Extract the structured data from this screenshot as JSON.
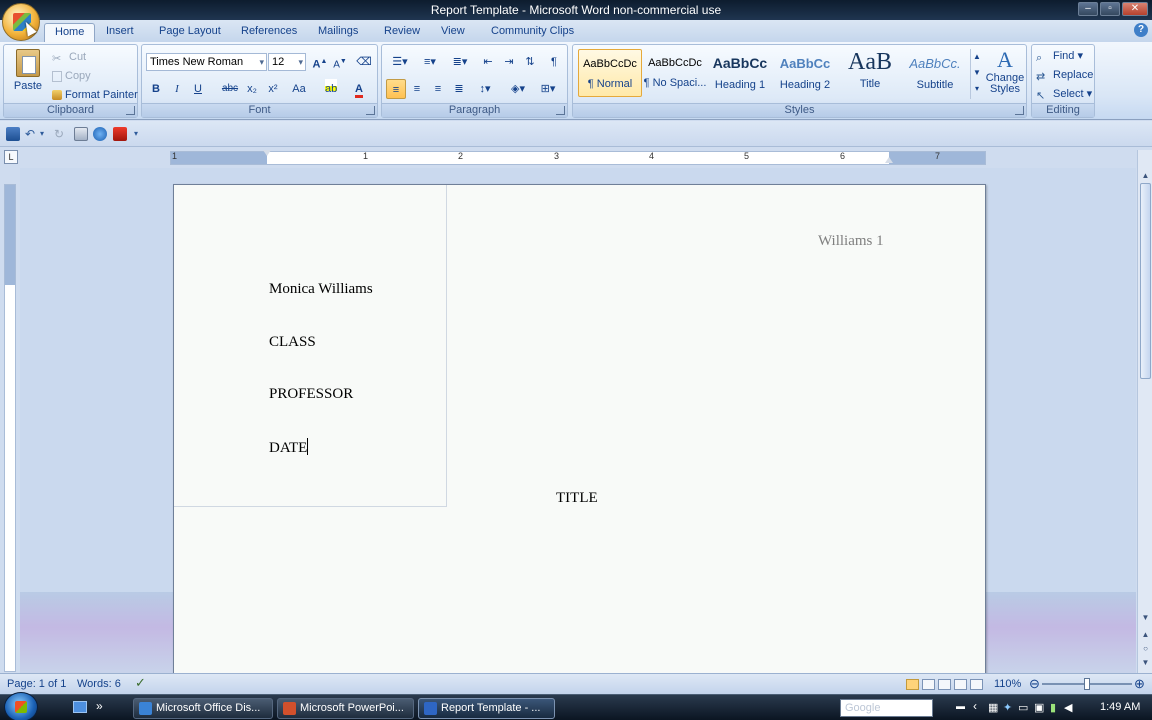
{
  "window": {
    "title": "Report Template - Microsoft Word non-commercial use"
  },
  "tabs": [
    "Home",
    "Insert",
    "Page Layout",
    "References",
    "Mailings",
    "Review",
    "View",
    "Community Clips"
  ],
  "clipboard": {
    "paste": "Paste",
    "cut": "Cut",
    "copy": "Copy",
    "format_painter": "Format Painter",
    "label": "Clipboard"
  },
  "font": {
    "name": "Times New Roman",
    "size": "12",
    "label": "Font",
    "bold": "B",
    "italic": "I",
    "underline": "U",
    "strike": "abc",
    "sub": "x₂",
    "sup": "x²",
    "case": "Aa",
    "grow": "A",
    "shrink": "A",
    "color": "A"
  },
  "paragraph": {
    "label": "Paragraph",
    "pilcrow": "¶"
  },
  "styles": {
    "label": "Styles",
    "items": [
      {
        "sample": "AaBbCcDc",
        "name": "¶ Normal"
      },
      {
        "sample": "AaBbCcDc",
        "name": "¶ No Spaci..."
      },
      {
        "sample": "AaBbCc",
        "name": "Heading 1"
      },
      {
        "sample": "AaBbCc",
        "name": "Heading 2"
      },
      {
        "sample": "AaB",
        "name": "Title"
      },
      {
        "sample": "AaBbCc.",
        "name": "Subtitle"
      }
    ],
    "change_styles": "Change Styles"
  },
  "editing": {
    "find": "Find",
    "replace": "Replace",
    "select": "Select",
    "label": "Editing"
  },
  "ruler": {
    "numbers": [
      "1",
      "1",
      "2",
      "3",
      "4",
      "5",
      "6",
      "7"
    ],
    "toggle": "L"
  },
  "document": {
    "header": "Williams 1",
    "lines": [
      "Monica Williams",
      "CLASS",
      "PROFESSOR",
      "DATE"
    ],
    "title": "TITLE"
  },
  "status": {
    "page": "Page: 1 of 1",
    "words": "Words: 6",
    "zoom": "110%"
  },
  "taskbar": {
    "items": [
      {
        "label": "Microsoft Office Dis...",
        "color": "#3a83d6"
      },
      {
        "label": "Microsoft PowerPoi...",
        "color": "#d2502c"
      },
      {
        "label": "Report Template - ...",
        "color": "#2e66c4"
      }
    ],
    "search_placeholder": "Google",
    "time": "1:49 AM"
  }
}
